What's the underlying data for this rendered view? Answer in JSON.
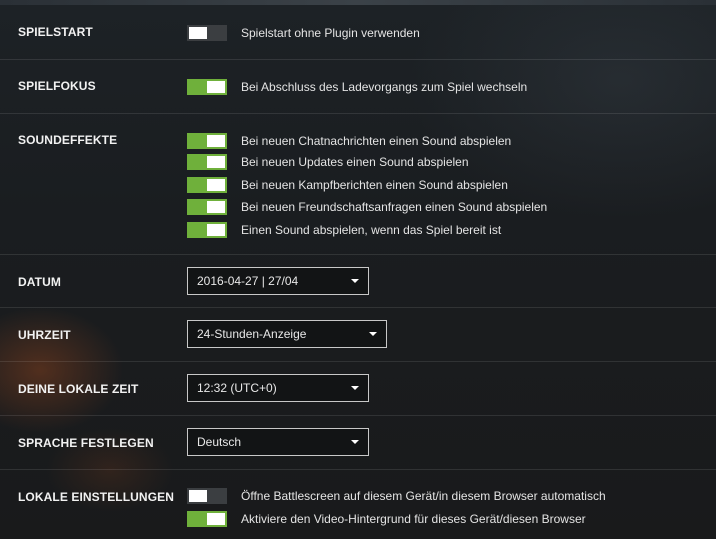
{
  "sections": {
    "spielstart": {
      "label": "SPIELSTART",
      "options": [
        {
          "label": "Spielstart ohne Plugin verwenden",
          "on": false
        }
      ]
    },
    "spielfokus": {
      "label": "SPIELFOKUS",
      "options": [
        {
          "label": "Bei Abschluss des Ladevorgangs zum Spiel wechseln",
          "on": true
        }
      ]
    },
    "soundeffekte": {
      "label": "SOUNDEFFEKTE",
      "options": [
        {
          "label": "Bei neuen Chatnachrichten einen Sound abspielen",
          "on": true
        },
        {
          "label": "Bei neuen Updates einen Sound abspielen",
          "on": true
        },
        {
          "label": "Bei neuen Kampfberichten einen Sound abspielen",
          "on": true
        },
        {
          "label": "Bei neuen Freundschaftsanfragen einen Sound abspielen",
          "on": true
        },
        {
          "label": "Einen Sound abspielen, wenn das Spiel bereit ist",
          "on": true
        }
      ]
    },
    "datum": {
      "label": "DATUM",
      "value": "2016-04-27 | 27/04"
    },
    "uhrzeit": {
      "label": "UHRZEIT",
      "value": "24-Stunden-Anzeige"
    },
    "lokale_zeit": {
      "label": "DEINE LOKALE ZEIT",
      "value": "12:32 (UTC+0)"
    },
    "sprache": {
      "label": "SPRACHE FESTLEGEN",
      "value": "Deutsch"
    },
    "lokale_einstellungen": {
      "label": "LOKALE EINSTELLUNGEN",
      "options": [
        {
          "label": "Öffne Battlescreen auf diesem Gerät/in diesem Browser automatisch",
          "on": false
        },
        {
          "label": "Aktiviere den Video-Hintergrund für dieses Gerät/diesen Browser",
          "on": true
        }
      ]
    }
  },
  "colors": {
    "toggle_on": "#6fb03b",
    "toggle_off": "#3b3e41"
  },
  "icons": {
    "dropdown": "caret-down-icon"
  }
}
